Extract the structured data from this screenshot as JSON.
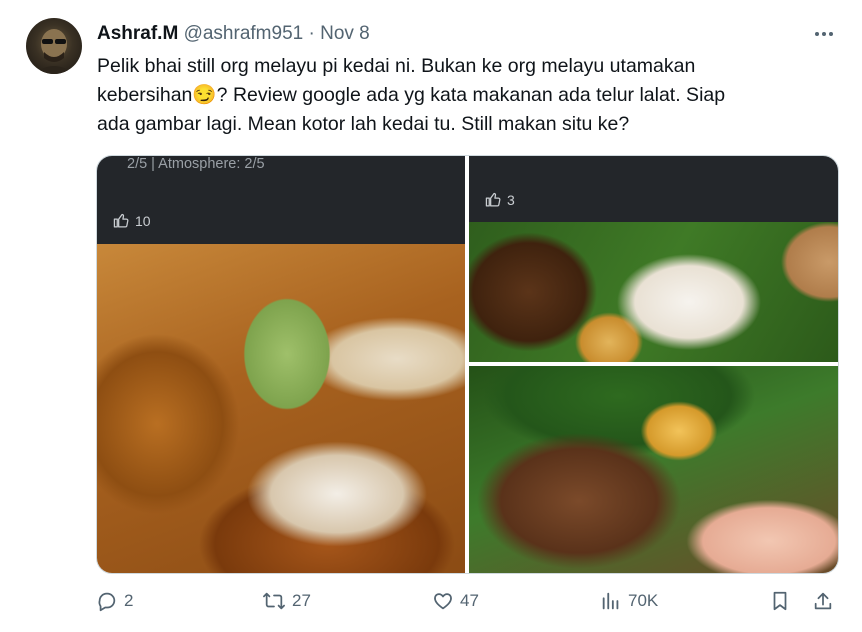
{
  "author": {
    "display_name": "Ashraf.M",
    "handle": "@ashrafm951",
    "separator": "·",
    "date": "Nov 8"
  },
  "tweet": {
    "line1": "Pelik bhai still org melayu pi kedai ni. Bukan ke org melayu utamakan",
    "line2": "kebersihan😏? Review google ada yg kata makanan ada telur lalat. Siap",
    "line3": "ada gambar lagi. Mean kotor lah kedai tu. Still makan situ ke?"
  },
  "media": {
    "image1": {
      "rating_text": "2/5  |  Atmosphere: 2/5",
      "likes": "10"
    },
    "image2": {
      "likes": "3"
    }
  },
  "actions": {
    "replies": "2",
    "reposts": "27",
    "likes": "47",
    "views": "70K"
  },
  "icons": {
    "more": "more-dots-icon",
    "reply": "reply-icon",
    "repost": "repost-icon",
    "like": "heart-icon",
    "views": "views-chart-icon",
    "bookmark": "bookmark-icon",
    "share": "share-icon"
  },
  "colors": {
    "text": "#0f1419",
    "muted": "#536471",
    "border": "#cfd9de"
  }
}
